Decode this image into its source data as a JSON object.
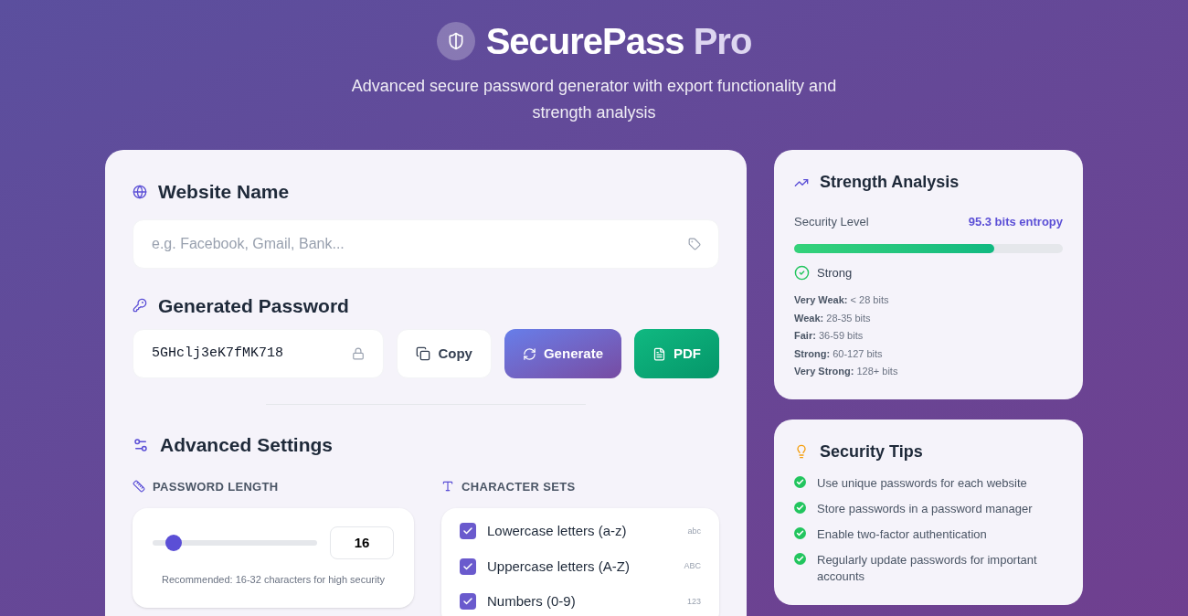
{
  "header": {
    "title": "SecurePass",
    "title_accent": "Pro",
    "subtitle": "Advanced secure password generator with export functionality and strength analysis"
  },
  "website": {
    "label": "Website Name",
    "placeholder": "e.g. Facebook, Gmail, Bank..."
  },
  "password": {
    "label": "Generated Password",
    "value": "5GHclj3eK7fMK718",
    "buttons": [
      {
        "kind": "copy",
        "label": "Copy"
      },
      {
        "kind": "generate",
        "label": "Generate"
      },
      {
        "kind": "pdf",
        "label": "PDF"
      }
    ]
  },
  "settings": {
    "title": "Advanced Settings",
    "length_label": "PASSWORD LENGTH",
    "length": {
      "level": 0.13,
      "value": "16",
      "hint": "Recommended: 16-32 characters for high security"
    },
    "charsets_label": "CHARACTER SETS",
    "charsets": [
      {
        "label": "Lowercase letters (a-z)",
        "sample": "abc",
        "checked": true
      },
      {
        "label": "Uppercase letters (A-Z)",
        "sample": "ABC",
        "checked": true
      },
      {
        "label": "Numbers (0-9)",
        "sample": "123",
        "checked": true
      }
    ]
  },
  "strength": {
    "title": "Strength Analysis",
    "level_label": "Security Level",
    "entropy": "95.3 bits entropy",
    "level": 0.745,
    "rating": "Strong",
    "ranges": [
      "**Very Weak:** < 28 bits",
      "**Weak:** 28-35 bits",
      "**Fair:** 36-59 bits",
      "**Strong:** 60-127 bits",
      "**Very Strong:** 128+ bits"
    ]
  },
  "tips": {
    "title": "Security Tips",
    "items": [
      "Use unique passwords for each website",
      "Store passwords in a password manager",
      "Enable two-factor authentication",
      "Regularly update passwords for important accounts"
    ]
  }
}
